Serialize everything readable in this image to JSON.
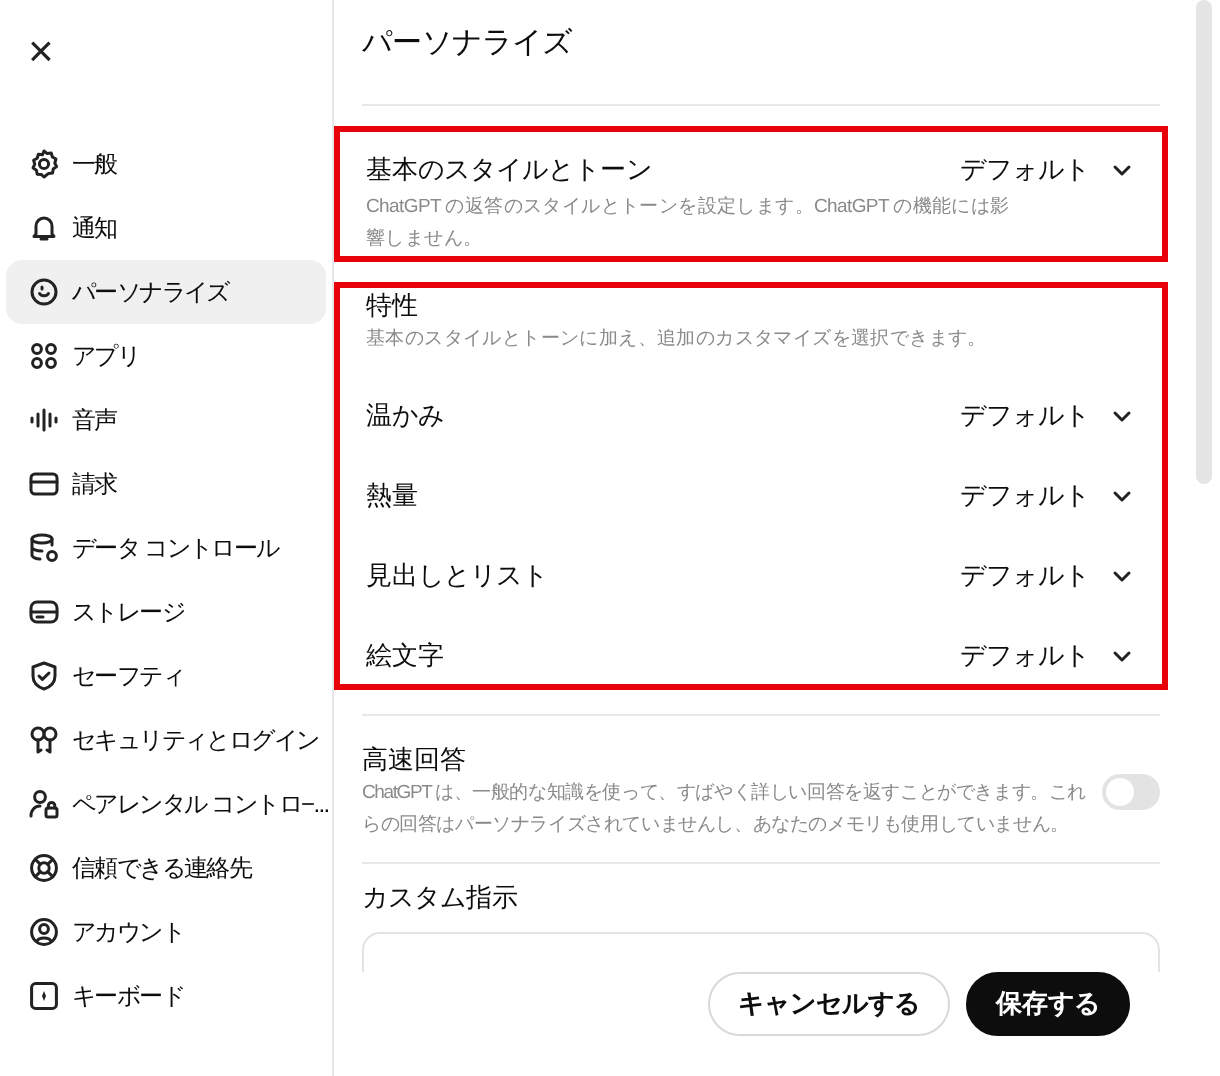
{
  "close_label": "×",
  "sidebar": {
    "items": [
      {
        "label": "一般",
        "selected": false
      },
      {
        "label": "通知",
        "selected": false
      },
      {
        "label": "パーソナライズ",
        "selected": true
      },
      {
        "label": "アプリ",
        "selected": false
      },
      {
        "label": "音声",
        "selected": false
      },
      {
        "label": "請求",
        "selected": false
      },
      {
        "label": "データ コントロール",
        "selected": false
      },
      {
        "label": "ストレージ",
        "selected": false
      },
      {
        "label": "セーフティ",
        "selected": false
      },
      {
        "label": "セキュリティとログイン",
        "selected": false
      },
      {
        "label": "ペアレンタル コントロ−...",
        "selected": false
      },
      {
        "label": "信頼できる連絡先",
        "selected": false
      },
      {
        "label": "アカウント",
        "selected": false
      },
      {
        "label": "キーボード",
        "selected": false
      }
    ]
  },
  "main": {
    "title": "パーソナライズ",
    "base_style": {
      "label": "基本のスタイルとトーン",
      "description": "ChatGPT の返答のスタイルとトーンを設定します。ChatGPT の機能には影響しません。",
      "value": "デフォルト",
      "highlighted": true
    },
    "traits": {
      "label": "特性",
      "description": "基本のスタイルとトーンに加え、追加のカスタマイズを選択できます。",
      "highlighted": true,
      "rows": [
        {
          "label": "温かみ",
          "value": "デフォルト"
        },
        {
          "label": "熱量",
          "value": "デフォルト"
        },
        {
          "label": "見出しとリスト",
          "value": "デフォルト"
        },
        {
          "label": "絵文字",
          "value": "デフォルト"
        }
      ]
    },
    "fast_answers": {
      "label": "高速回答",
      "description": "ChatGPT は、一般的な知識を使って、すばやく詳しい回答を返すことができます。これらの回答はパーソナライズされていませんし、あなたのメモリも使用していません。",
      "on": false
    },
    "custom_instructions": {
      "label": "カスタム指示"
    }
  },
  "buttons": [
    {
      "label": "キャンセルする",
      "kind": "secondary"
    },
    {
      "label": "保存する",
      "kind": "primary"
    }
  ]
}
